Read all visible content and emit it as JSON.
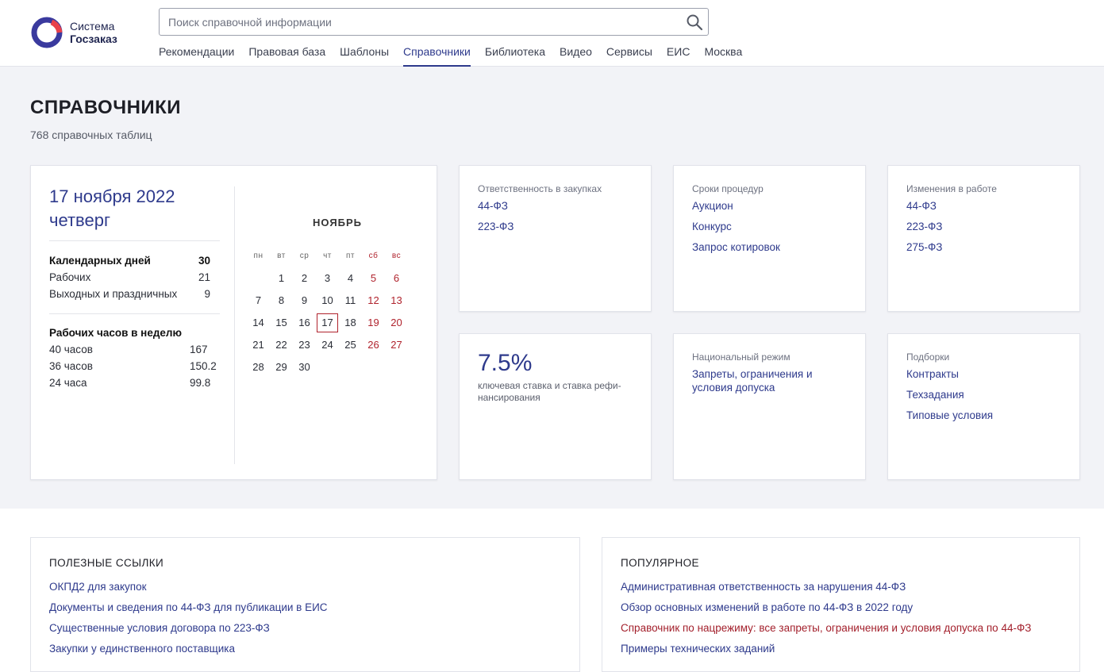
{
  "brand": {
    "line1": "Система",
    "line2": "Госзаказ"
  },
  "search": {
    "placeholder": "Поиск справочной информации",
    "value": ""
  },
  "nav": {
    "items": [
      {
        "label": "Рекомендации"
      },
      {
        "label": "Правовая база"
      },
      {
        "label": "Шаблоны"
      },
      {
        "label": "Справочники",
        "active": true
      },
      {
        "label": "Библиотека"
      },
      {
        "label": "Видео"
      },
      {
        "label": "Сервисы"
      },
      {
        "label": "ЕИС"
      },
      {
        "label": "Москва"
      }
    ]
  },
  "page": {
    "title": "СПРАВОЧНИКИ",
    "subtitle": "768 справочных таблиц"
  },
  "calendar": {
    "date": "17 ноября 2022",
    "weekday": "четверг",
    "days_head": {
      "label": "Календарных дней",
      "value": "30"
    },
    "days": [
      {
        "label": "Рабочих",
        "value": "21"
      },
      {
        "label": "Выходных и праздничных",
        "value": "9"
      }
    ],
    "hours_head": {
      "label": "Рабочих часов в неделю"
    },
    "hours": [
      {
        "label": "40 часов",
        "value": "167"
      },
      {
        "label": "36 часов",
        "value": "150.2"
      },
      {
        "label": "24 часа",
        "value": "99.8"
      }
    ],
    "month": "НОЯБРЬ",
    "weekdays": [
      "пн",
      "вт",
      "ср",
      "чт",
      "пт",
      "сб",
      "вс"
    ],
    "weeks": [
      [
        "",
        "1",
        "2",
        "3",
        "4",
        "5",
        "6"
      ],
      [
        "7",
        "8",
        "9",
        "10",
        "11",
        "12",
        "13"
      ],
      [
        "14",
        "15",
        "16",
        "17",
        "18",
        "19",
        "20"
      ],
      [
        "21",
        "22",
        "23",
        "24",
        "25",
        "26",
        "27"
      ],
      [
        "28",
        "29",
        "30",
        "",
        "",
        "",
        ""
      ]
    ],
    "today": "17",
    "weekend_color": "#b0232d"
  },
  "cards": {
    "responsibility": {
      "label": "Ответственность в закупках",
      "links": [
        "44-ФЗ",
        "223-ФЗ"
      ]
    },
    "deadlines": {
      "label": "Сроки процедур",
      "links": [
        "Аукцион",
        "Конкурс",
        "Запрос котировок"
      ]
    },
    "changes": {
      "label": "Изменения в работе",
      "links": [
        "44-ФЗ",
        "223-ФЗ",
        "275-ФЗ"
      ]
    },
    "rate": {
      "value": "7.5%",
      "text": "ключевая ставка и ставка рефи-нансирования"
    },
    "national": {
      "label": "Национальный режим",
      "links": [
        "Запреты, ограничения и условия допуска"
      ]
    },
    "collections": {
      "label": "Подборки",
      "links": [
        "Контракты",
        "Техзадания",
        "Типовые условия"
      ]
    }
  },
  "useful": {
    "title": "ПОЛЕЗНЫЕ ССЫЛКИ",
    "links": [
      "ОКПД2 для закупок",
      "Документы и сведения по 44-ФЗ для публикации в ЕИС",
      "Существенные условия договора по 223-ФЗ",
      "Закупки у единственного поставщика"
    ]
  },
  "popular": {
    "title": "ПОПУЛЯРНОЕ",
    "links": [
      "Административная ответственность за нарушения 44-ФЗ",
      "Обзор основных изменений в работе по 44-ФЗ в 2022 году",
      "Справочник по нацрежиму: все запреты, ограничения и условия допуска по 44-ФЗ",
      "Примеры технических заданий"
    ]
  },
  "colors": {
    "accent": "#2e3a8c",
    "red": "#b0232d",
    "bg": "#f2f3f7"
  }
}
